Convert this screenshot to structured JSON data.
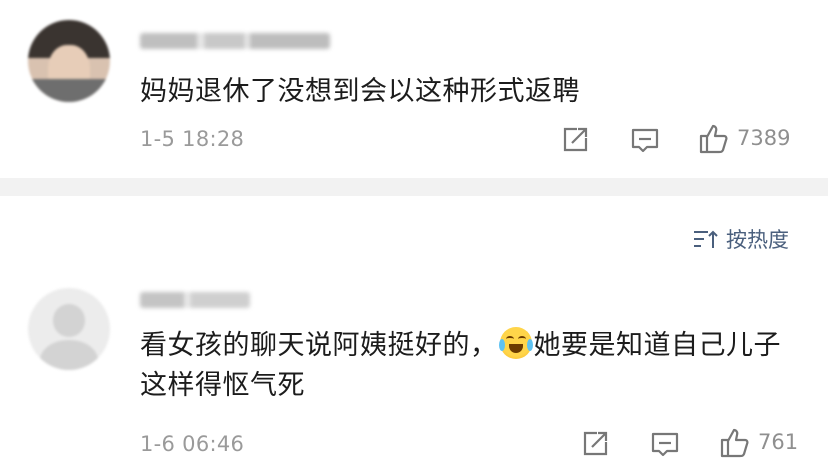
{
  "comments": [
    {
      "text": "妈妈退休了没想到会以这种形式返聘",
      "time": "1-5 18:28",
      "likes": "7389"
    },
    {
      "text_before": "看女孩的聊天说阿姨挺好的，",
      "emoji": "laughing-crying-emoji",
      "text_after": "她要是知道自己儿子这样得怄气死",
      "time": "1-6 06:46",
      "likes": "761"
    }
  ],
  "sort": {
    "label": "按热度"
  },
  "colors": {
    "accent": "#4a5f7d",
    "muted": "#9a9a9a",
    "divider": "#f2f2f2"
  }
}
